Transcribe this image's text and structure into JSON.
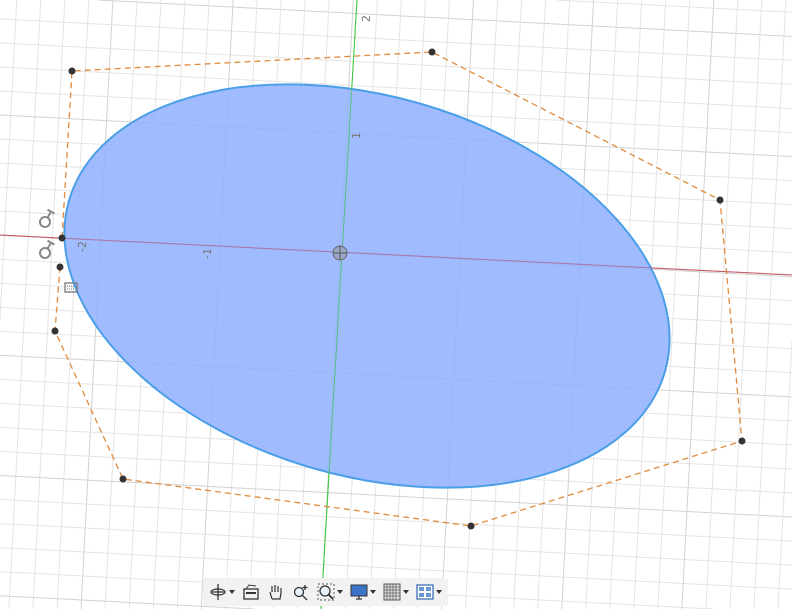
{
  "colors": {
    "grid": "#e4e4e4",
    "grid_major": "#d2d2d2",
    "x_axis": "#d9534f",
    "y_axis": "#3ec83e",
    "profile_fill": "#8fb0ff",
    "profile_stroke": "#4a9fe8",
    "control_polygon": "#e08a3c",
    "point": "#333333"
  },
  "axis_labels": {
    "y_pos2": "2",
    "y_pos1": "1",
    "x_neg1": "-1",
    "x_neg2": "-2"
  },
  "toolbar": {
    "items": [
      {
        "icon": "orbit-icon",
        "has_menu": true
      },
      {
        "icon": "look-at-icon",
        "has_menu": false
      },
      {
        "icon": "pan-hand-icon",
        "has_menu": false
      },
      {
        "icon": "zoom-icon",
        "has_menu": false
      },
      {
        "icon": "fit-zoom-window-icon",
        "has_menu": true
      },
      {
        "icon": "display-settings-icon",
        "has_menu": true
      },
      {
        "icon": "grid-snaps-icon",
        "has_menu": true
      },
      {
        "icon": "viewports-icon",
        "has_menu": true
      }
    ]
  }
}
